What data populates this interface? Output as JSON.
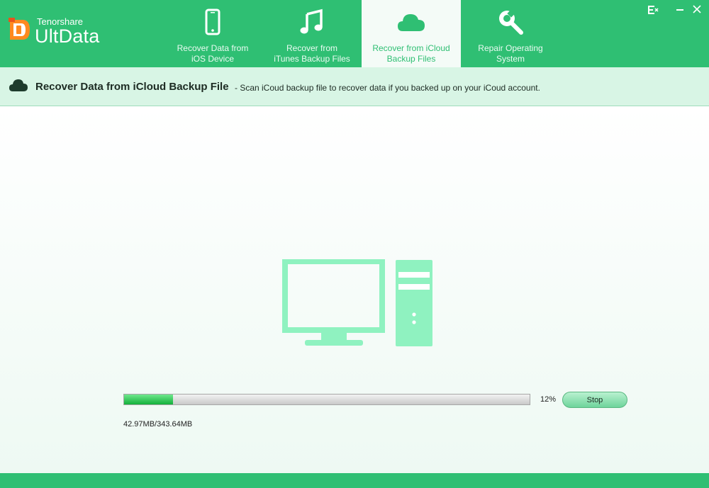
{
  "app": {
    "vendor": "Tenorshare",
    "name": "UltData"
  },
  "tabs": [
    {
      "label_line1": "Recover Data from",
      "label_line2": "iOS Device",
      "icon": "phone-icon"
    },
    {
      "label_line1": "Recover from",
      "label_line2": "iTunes Backup Files",
      "icon": "music-note-icon"
    },
    {
      "label_line1": "Recover from iCloud",
      "label_line2": "Backup Files",
      "icon": "cloud-icon",
      "active": true
    },
    {
      "label_line1": "Repair Operating",
      "label_line2": "System",
      "icon": "wrench-icon"
    }
  ],
  "section": {
    "title": "Recover Data from iCloud Backup File",
    "description": "- Scan iCoud backup file to recover data if you backed up on your iCoud account."
  },
  "progress": {
    "percent_label": "12%",
    "fraction": 0.12,
    "size_label": "42.97MB/343.64MB"
  },
  "buttons": {
    "stop": "Stop"
  },
  "colors": {
    "accent": "#2fbf73",
    "header_bg": "#d8f5e5",
    "illustration": "#8ff2c0",
    "progress_fill": "#13b03a"
  }
}
